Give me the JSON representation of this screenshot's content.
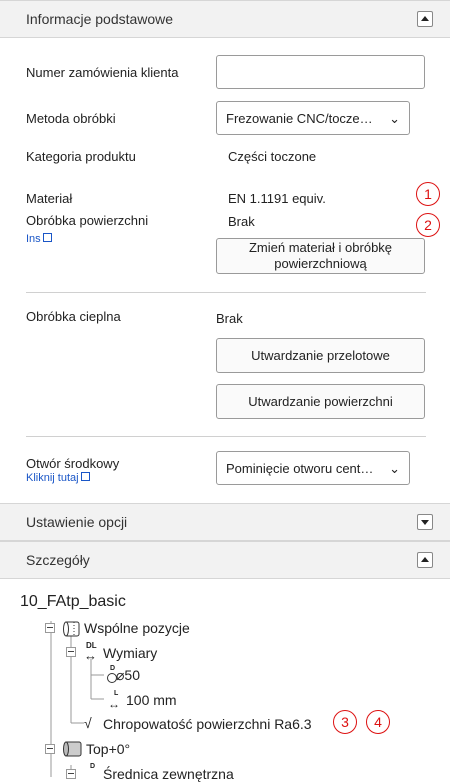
{
  "basic": {
    "title": "Informacje podstawowe",
    "order_number_label": "Numer zamówienia klienta",
    "order_number_value": "",
    "method_label": "Metoda obróbki",
    "method_value": "Frezowanie CNC/tocze…",
    "category_label": "Kategoria produktu",
    "category_value": "Części toczone",
    "material_label": "Materiał",
    "material_value": "EN 1.1191 equiv.",
    "surface_label": "Obróbka powierzchni",
    "surface_value": "Brak",
    "surface_link": "Ins",
    "change_button": "Zmień materiał i obróbkę powierzchniową",
    "heat_label": "Obróbka cieplna",
    "heat_value": "Brak",
    "through_button": "Utwardzanie przelotowe",
    "surface_hardening_button": "Utwardzanie powierzchni",
    "center_hole_label": "Otwór środkowy",
    "center_hole_link": "Kliknij tutaj",
    "center_hole_value": "Pominięcie otworu cent…"
  },
  "badges": [
    "1",
    "2",
    "3",
    "4"
  ],
  "options": {
    "title": "Ustawienie opcji"
  },
  "details": {
    "title": "Szczegóły",
    "root": "10_FAtp_basic",
    "common": "Wspólne pozycje",
    "dims": "Wymiary",
    "dims_icon": "DL",
    "diameter": "⌀50",
    "diameter_icon": "D",
    "length": "100 mm",
    "length_icon": "L",
    "roughness": "Chropowatość powierzchni Ra6.3",
    "top": "Top+0°",
    "outer_diameter": "Średnica zewnętrzna",
    "outer_diameter_icon": "D"
  }
}
